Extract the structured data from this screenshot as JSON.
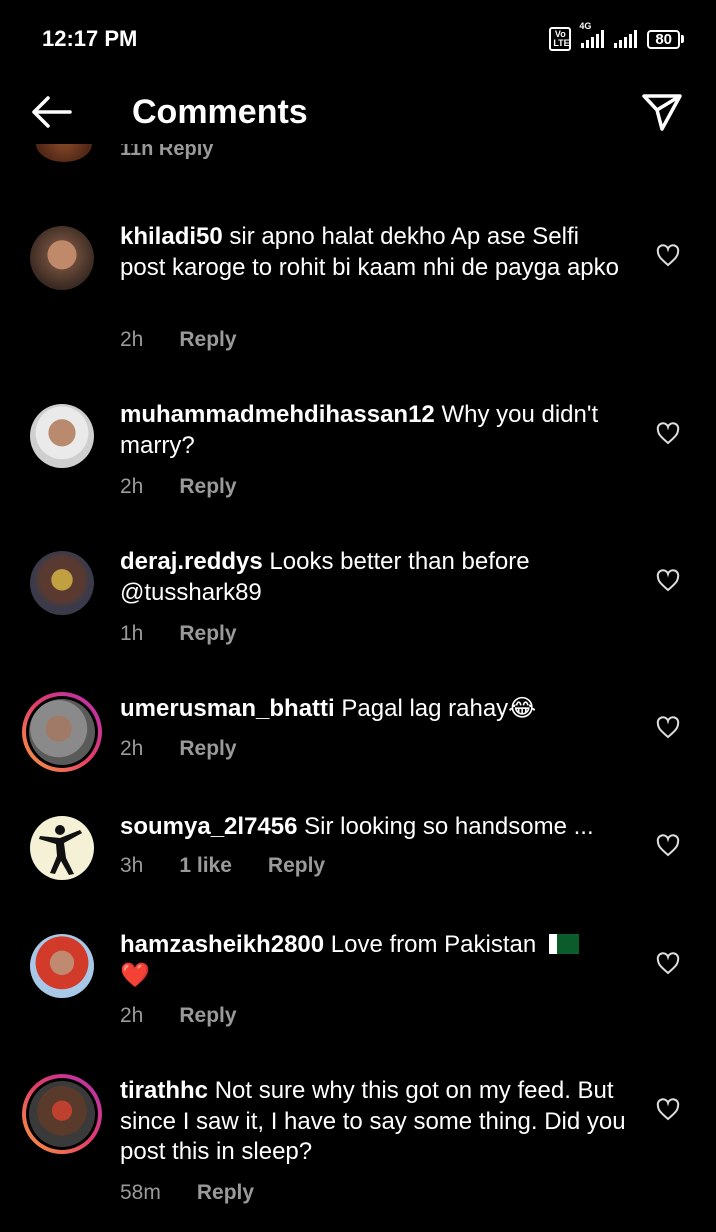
{
  "status": {
    "time": "12:17 PM",
    "volte": "Vo LTE",
    "network": "4G",
    "battery": "80"
  },
  "header": {
    "title": "Comments"
  },
  "comments": [
    {
      "user": "khiladi50",
      "text": "sir apno halat dekho Ap ase Selfi post karoge to rohit bi kaam nhi de payga apko",
      "time": "2h",
      "likes": "",
      "reply": "Reply"
    },
    {
      "user": "muhammadmehdihassan12",
      "text": "Why you didn't marry?",
      "time": "2h",
      "likes": "",
      "reply": "Reply"
    },
    {
      "user": "deraj.reddys",
      "text": "Looks better than before @tusshark89",
      "time": "1h",
      "likes": "",
      "reply": "Reply"
    },
    {
      "user": "umerusman_bhatti",
      "text": "Pagal lag rahay😂",
      "time": "2h",
      "likes": "",
      "reply": "Reply"
    },
    {
      "user": "soumya_2l7456",
      "text": "Sir looking so handsome ...",
      "time": "3h",
      "likes": "1 like",
      "reply": "Reply"
    },
    {
      "user": "hamzasheikh2800",
      "text": "Love from Pakistan",
      "emoji_after": "❤️",
      "time": "2h",
      "likes": "",
      "reply": "Reply"
    },
    {
      "user": "tirathhc",
      "text": "Not sure why this got on my feed. But since I saw it, I have to say some thing. Did you post this in sleep?",
      "time": "58m",
      "likes": "",
      "reply": "Reply"
    }
  ],
  "partial_top": {
    "text": "11h   Reply"
  }
}
